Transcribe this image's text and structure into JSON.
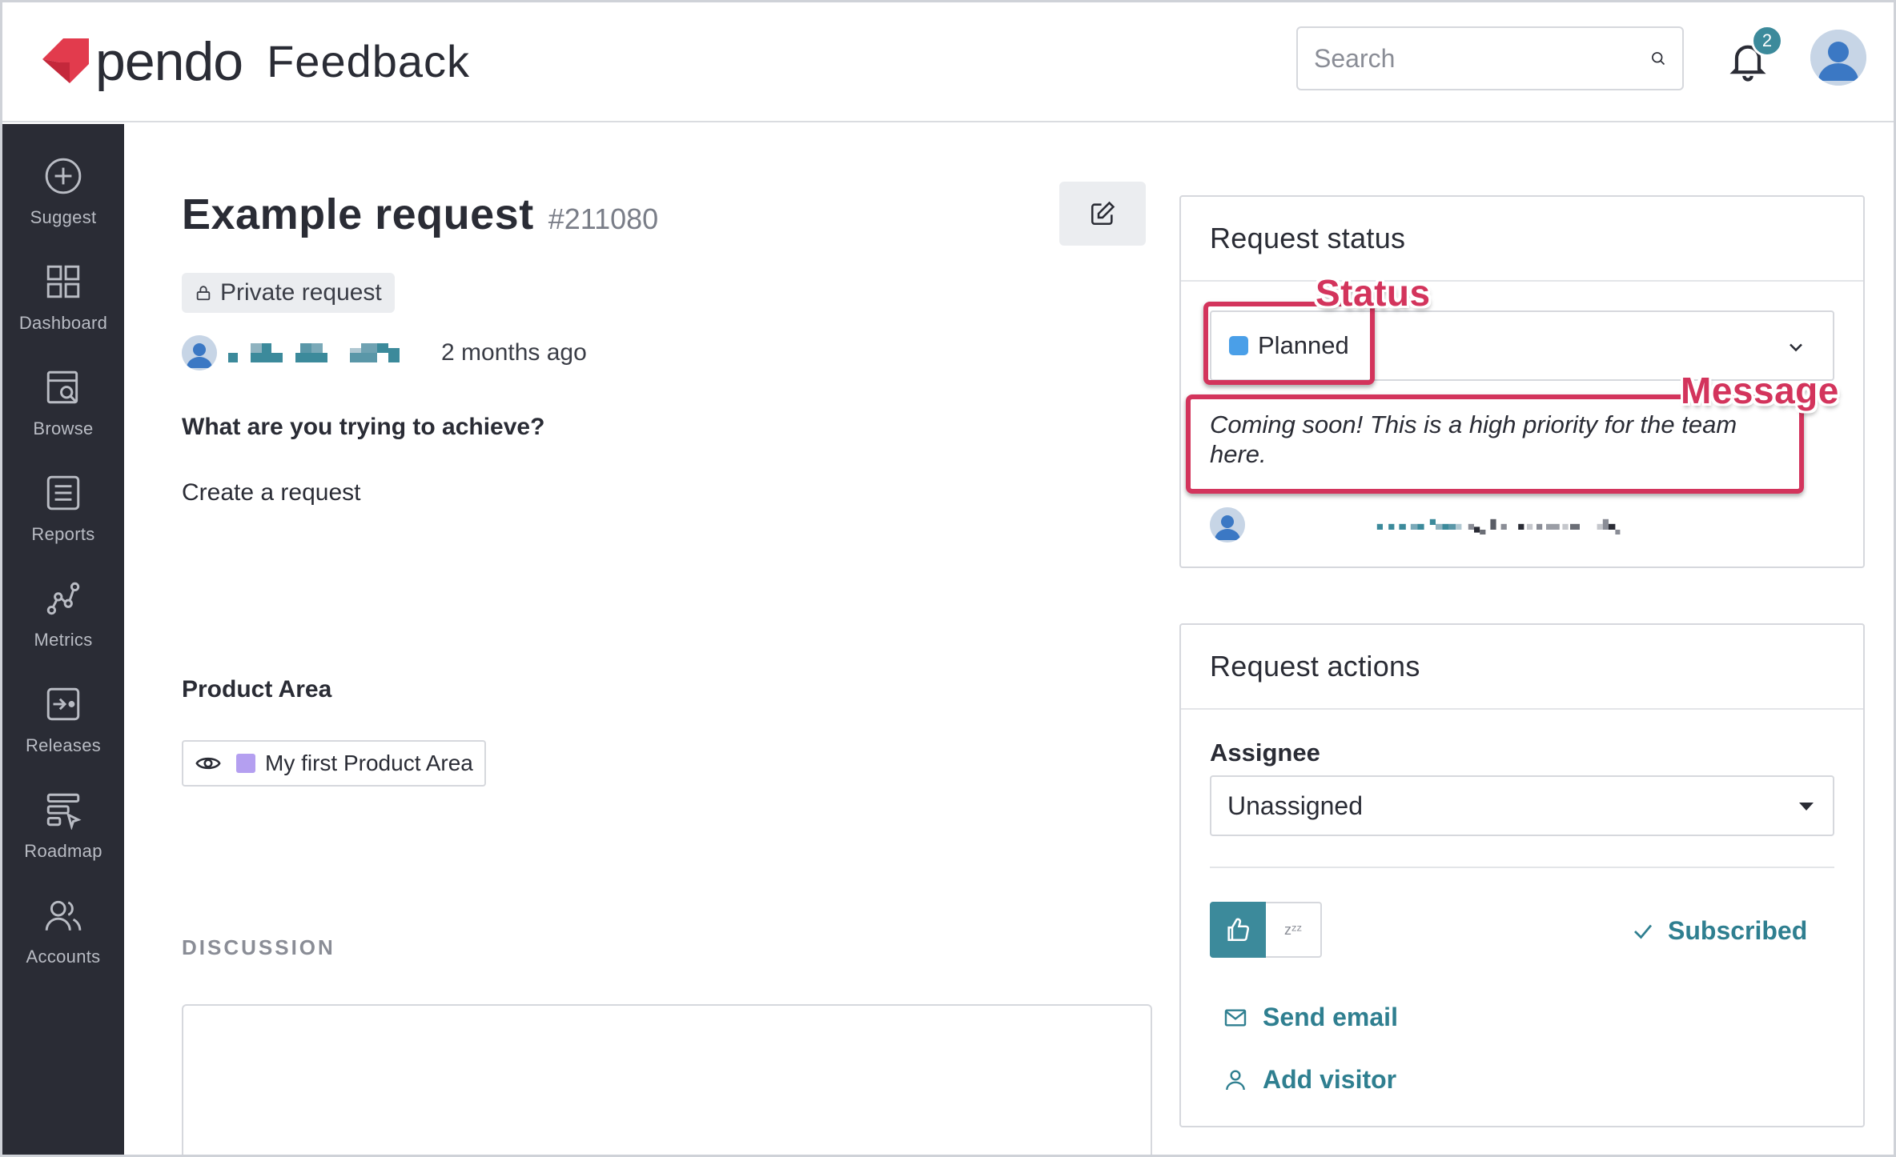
{
  "app": {
    "logo_word": "pendo",
    "product": "Feedback"
  },
  "header": {
    "search_placeholder": "Search",
    "notification_count": "2"
  },
  "sidebar": {
    "items": [
      {
        "label": "Suggest",
        "icon": "plus-circle-icon"
      },
      {
        "label": "Dashboard",
        "icon": "grid-icon"
      },
      {
        "label": "Browse",
        "icon": "browse-icon"
      },
      {
        "label": "Reports",
        "icon": "list-icon"
      },
      {
        "label": "Metrics",
        "icon": "metrics-icon"
      },
      {
        "label": "Releases",
        "icon": "releases-icon"
      },
      {
        "label": "Roadmap",
        "icon": "roadmap-icon"
      },
      {
        "label": "Accounts",
        "icon": "accounts-icon"
      }
    ]
  },
  "request": {
    "title": "Example request",
    "id": "#211080",
    "visibility": "Private request",
    "time_ago": "2 months ago",
    "question": "What are you trying to achieve?",
    "answer": "Create a request",
    "product_area_label": "Product Area",
    "product_area": "My first Product Area",
    "product_area_color": "#b49ff0",
    "discussion_label": "DISCUSSION"
  },
  "status_card": {
    "title": "Request status",
    "status": "Planned",
    "status_color": "#4a9fe8",
    "message": "Coming soon! This is a high priority for the team here."
  },
  "actions_card": {
    "title": "Request actions",
    "assignee_label": "Assignee",
    "assignee_value": "Unassigned",
    "snooze_glyph": "zᶻᶻ",
    "subscribed": "Subscribed",
    "send_email": "Send email",
    "add_visitor": "Add visitor"
  },
  "annotations": {
    "status": "Status",
    "message": "Message",
    "color": "#d3345c"
  },
  "colors": {
    "accent": "#3c8a9b",
    "sidebar": "#2a2c35",
    "link": "#2f7f90"
  }
}
